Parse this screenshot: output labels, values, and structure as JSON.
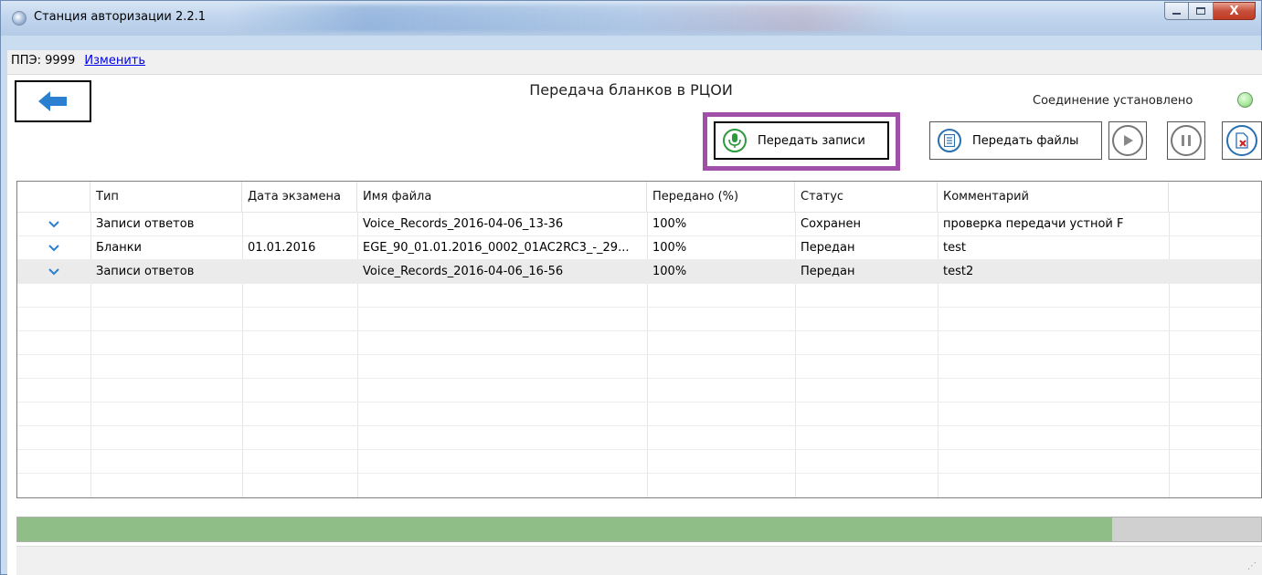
{
  "window": {
    "title": "Станция авторизации 2.2.1",
    "close_glyph": "X"
  },
  "ppe": {
    "label": "ППЭ: 9999",
    "change_link": "Изменить"
  },
  "header": {
    "title": "Передача бланков в РЦОИ",
    "connection_status": "Соединение установлено",
    "connection_color": "#a8e69a"
  },
  "toolbar": {
    "send_records_label": "Передать записи",
    "send_files_label": "Передать файлы",
    "highlight_color": "#a050a8"
  },
  "table": {
    "columns": [
      "Тип",
      "Дата экзамена",
      "Имя файла",
      "Передано (%)",
      "Статус",
      "Комментарий"
    ],
    "rows": [
      {
        "type": "Записи ответов",
        "date": "",
        "file": "Voice_Records_2016-04-06_13-36",
        "percent": "100%",
        "status": "Сохранен",
        "comment": "проверка передачи устной F"
      },
      {
        "type": "Бланки",
        "date": "01.01.2016",
        "file": "EGE_90_01.01.2016_0002_01AC2RC3_-_29...",
        "percent": "100%",
        "status": "Передан",
        "comment": "test"
      },
      {
        "type": "Записи ответов",
        "date": "",
        "file": "Voice_Records_2016-04-06_16-56",
        "percent": "100%",
        "status": "Передан",
        "comment": "test2"
      }
    ],
    "selected_row": 2
  },
  "progress": {
    "fraction": 0.88,
    "color": "#8fbe87"
  },
  "icons": [
    "app-icon",
    "back-arrow-icon",
    "microphone-icon",
    "document-icon",
    "play-icon",
    "pause-icon",
    "delete-file-icon",
    "expand-chevron-icon",
    "resize-grip-icon"
  ]
}
